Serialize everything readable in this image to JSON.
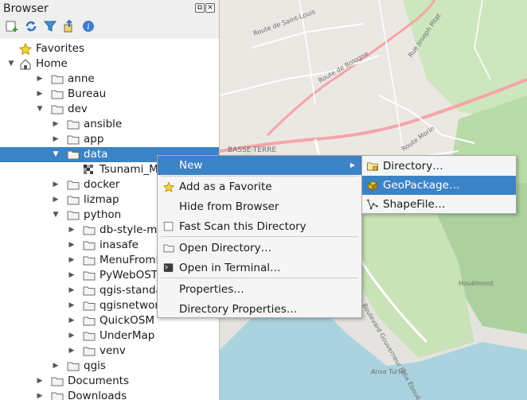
{
  "panel": {
    "title": "Browser",
    "title_buttons": [
      "float-icon",
      "close-icon"
    ],
    "toolbar": [
      "add-layer-icon",
      "refresh-icon",
      "filter-icon",
      "collapse-all-icon",
      "info-icon"
    ]
  },
  "tree": {
    "items": [
      {
        "label": "Favorites",
        "icon": "star-icon",
        "arrow": "",
        "selected": false
      },
      {
        "label": "Home",
        "icon": "home-icon",
        "arrow": "expanded",
        "selected": false
      },
      {
        "label": "anne",
        "icon": "folder-icon",
        "arrow": "collapsed",
        "selected": false
      },
      {
        "label": "Bureau",
        "icon": "folder-icon",
        "arrow": "collapsed",
        "selected": false
      },
      {
        "label": "dev",
        "icon": "folder-icon",
        "arrow": "expanded",
        "selected": false
      },
      {
        "label": "ansible",
        "icon": "folder-icon",
        "arrow": "collapsed",
        "selected": false
      },
      {
        "label": "app",
        "icon": "folder-icon",
        "arrow": "collapsed",
        "selected": false
      },
      {
        "label": "data",
        "icon": "folder-icon",
        "arrow": "expanded",
        "selected": true
      },
      {
        "label": "Tsunami_Mau",
        "icon": "raster-icon",
        "arrow": "",
        "selected": false
      },
      {
        "label": "docker",
        "icon": "folder-icon",
        "arrow": "collapsed",
        "selected": false
      },
      {
        "label": "lizmap",
        "icon": "folder-icon",
        "arrow": "collapsed",
        "selected": false
      },
      {
        "label": "python",
        "icon": "folder-icon",
        "arrow": "expanded",
        "selected": false
      },
      {
        "label": "db-style-mana",
        "icon": "folder-icon",
        "arrow": "collapsed",
        "selected": false
      },
      {
        "label": "inasafe",
        "icon": "folder-icon",
        "arrow": "collapsed",
        "selected": false
      },
      {
        "label": "MenuFromPro",
        "icon": "folder-icon",
        "arrow": "collapsed",
        "selected": false
      },
      {
        "label": "PyWebOSTV",
        "icon": "folder-icon",
        "arrow": "collapsed",
        "selected": false
      },
      {
        "label": "qgis-standalo",
        "icon": "folder-icon",
        "arrow": "collapsed",
        "selected": false
      },
      {
        "label": "qgisnetworklo",
        "icon": "folder-icon",
        "arrow": "collapsed",
        "selected": false
      },
      {
        "label": "QuickOSM",
        "icon": "folder-icon",
        "arrow": "collapsed",
        "selected": false
      },
      {
        "label": "UnderMap",
        "icon": "folder-icon",
        "arrow": "collapsed",
        "selected": false
      },
      {
        "label": "venv",
        "icon": "folder-icon",
        "arrow": "collapsed",
        "selected": false
      },
      {
        "label": "qgis",
        "icon": "folder-icon",
        "arrow": "collapsed",
        "selected": false
      },
      {
        "label": "Documents",
        "icon": "folder-icon",
        "arrow": "collapsed",
        "selected": false
      },
      {
        "label": "Downloads",
        "icon": "folder-icon",
        "arrow": "collapsed",
        "selected": false
      }
    ]
  },
  "context_menu": {
    "items": [
      {
        "label": "New",
        "icon": "",
        "submenu": true,
        "highlighted": true
      },
      {
        "label": "Add as a Favorite",
        "icon": "star-icon"
      },
      {
        "label": "Hide from Browser",
        "icon": ""
      },
      {
        "label": "Fast Scan this Directory",
        "icon": "checkbox-icon"
      },
      {
        "label": "Open Directory…",
        "icon": "folder-icon"
      },
      {
        "label": "Open in Terminal…",
        "icon": "terminal-icon"
      },
      {
        "label": "Properties…",
        "icon": ""
      },
      {
        "label": "Directory Properties…",
        "icon": ""
      }
    ]
  },
  "submenu": {
    "items": [
      {
        "label": "Directory…",
        "icon": "new-folder-icon",
        "highlighted": false
      },
      {
        "label": "GeoPackage…",
        "icon": "geopackage-icon",
        "highlighted": true
      },
      {
        "label": "ShapeFile…",
        "icon": "shapefile-icon",
        "highlighted": false
      }
    ]
  },
  "map": {
    "labels": {
      "road_saint_louis": "Route de Saint-Louis",
      "road_bologne": "Route de Bologne",
      "road_joseph": "Rue Joseph Pitat",
      "district": "BASSE-TERRE",
      "road_morin": "Route Morin",
      "boulevard": "Boulevard Gouverneur Félix Éboué",
      "anse": "Anse Turlet",
      "houelmont": "Houëlmont"
    }
  },
  "colors": {
    "selection": "#3c83c6",
    "sea": "#aad3df",
    "vegetation": "#add19e",
    "urban": "#e0dfdf",
    "primary_road": "#f6a5a8"
  }
}
